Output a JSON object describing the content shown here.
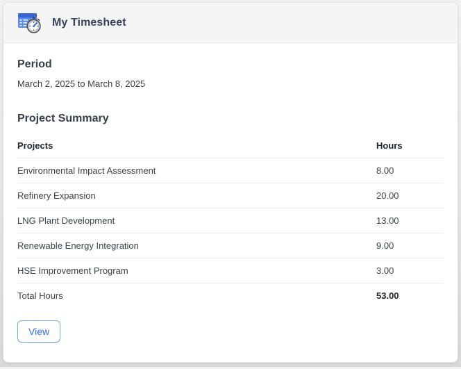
{
  "colors": {
    "primary_blue": "#2d6bf0",
    "title_slate": "#36415c",
    "header_bg": "#f5f5f6",
    "page_bg": "#e6e6e6",
    "icon_table_blue": "#5e8beb",
    "icon_header_blue": "#3566d6"
  },
  "header": {
    "title": "My Timesheet",
    "icon": "timesheet-icon"
  },
  "period": {
    "heading": "Period",
    "range": "March 2, 2025 to March 8, 2025"
  },
  "summary": {
    "heading": "Project Summary",
    "table": {
      "columns": [
        "Projects",
        "Hours"
      ],
      "rows": [
        {
          "project": "Environmental Impact Assessment",
          "hours": "8.00"
        },
        {
          "project": "Refinery Expansion",
          "hours": "20.00"
        },
        {
          "project": "LNG Plant Development",
          "hours": "13.00"
        },
        {
          "project": "Renewable Energy Integration",
          "hours": "9.00"
        },
        {
          "project": "HSE Improvement Program",
          "hours": "3.00"
        }
      ],
      "total_label": "Total Hours",
      "total_value": "53.00"
    }
  },
  "actions": {
    "view_label": "View"
  }
}
